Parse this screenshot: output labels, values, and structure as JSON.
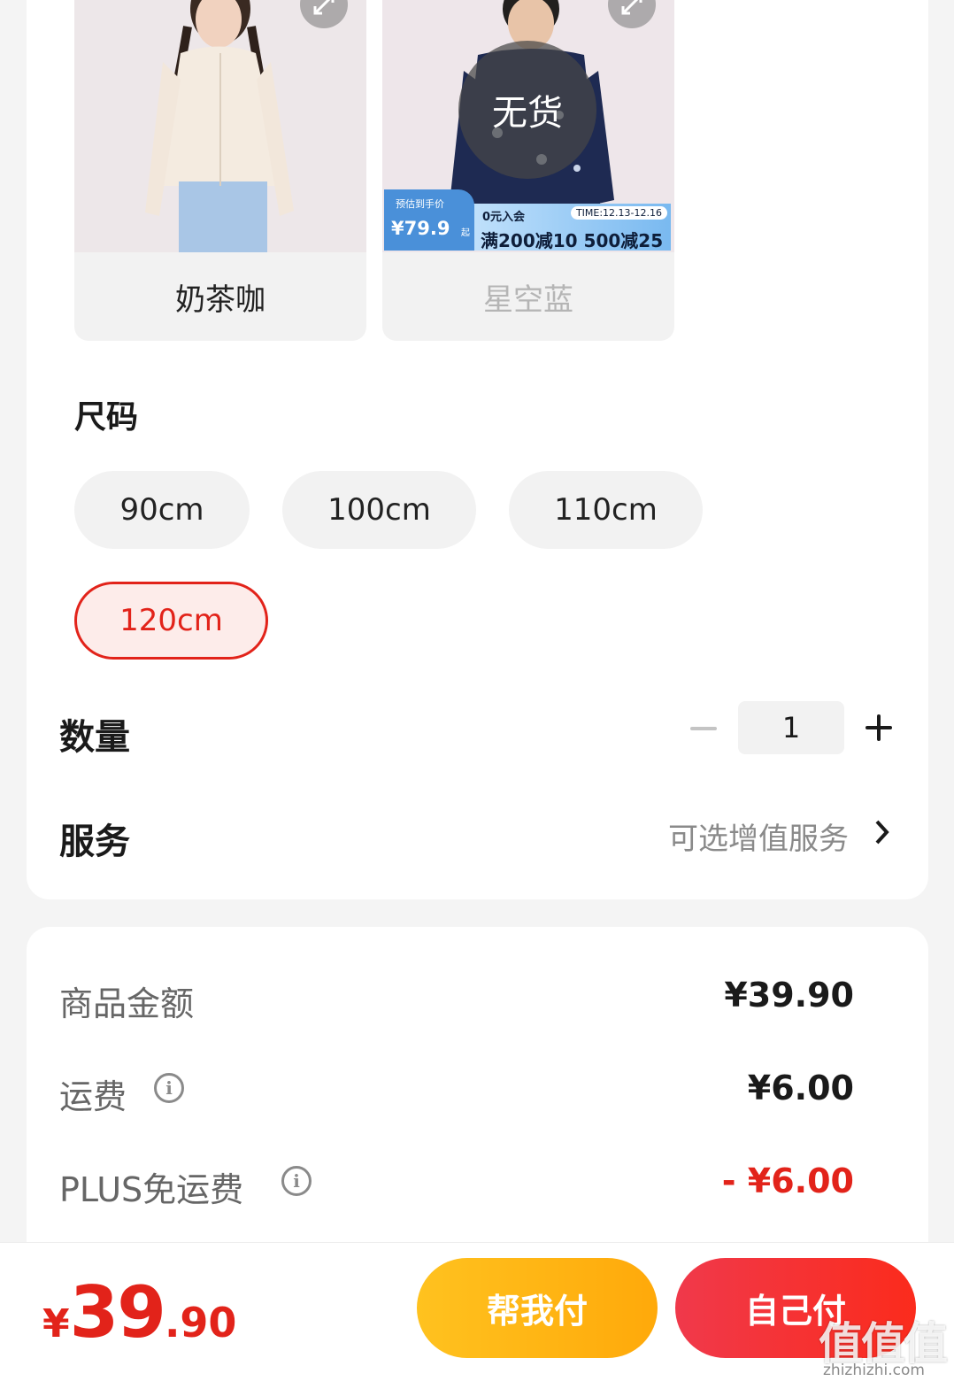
{
  "colors": [
    {
      "name": "奶茶咖",
      "available": true
    },
    {
      "name": "星空蓝",
      "available": false,
      "badge": "无货"
    }
  ],
  "promo": {
    "est_label": "预估到手价",
    "est_price": "¥79.9",
    "est_suffix": "起",
    "join": "0元入会",
    "time": "TIME:12.13-12.16",
    "deal": "满200减10 500减25"
  },
  "size_section": {
    "title": "尺码",
    "options": [
      {
        "label": "90cm",
        "selected": false
      },
      {
        "label": "100cm",
        "selected": false
      },
      {
        "label": "110cm",
        "selected": false
      },
      {
        "label": "120cm",
        "selected": true
      }
    ]
  },
  "quantity": {
    "title": "数量",
    "value": "1"
  },
  "service": {
    "title": "服务",
    "value": "可选增值服务"
  },
  "price_summary": {
    "goods_label": "商品金额",
    "goods_value": "¥39.90",
    "shipping_label": "运费",
    "shipping_value": "¥6.00",
    "plus_label": "PLUS免运费",
    "plus_value": "- ¥6.00"
  },
  "footer": {
    "total_currency": "¥",
    "total_integer": "39",
    "total_decimal": ".90",
    "help_pay_label": "帮我付",
    "self_pay_label": "自己付"
  },
  "watermark": {
    "text": "值值值",
    "url": "zhizhizhi.com"
  },
  "accent": {
    "red": "#e2231a",
    "yellow": "#ffb20f",
    "blue": "#4a90d9"
  },
  "icons": [
    "expand-icon",
    "minus-icon",
    "plus-icon",
    "chevron-right-icon",
    "info-icon"
  ]
}
